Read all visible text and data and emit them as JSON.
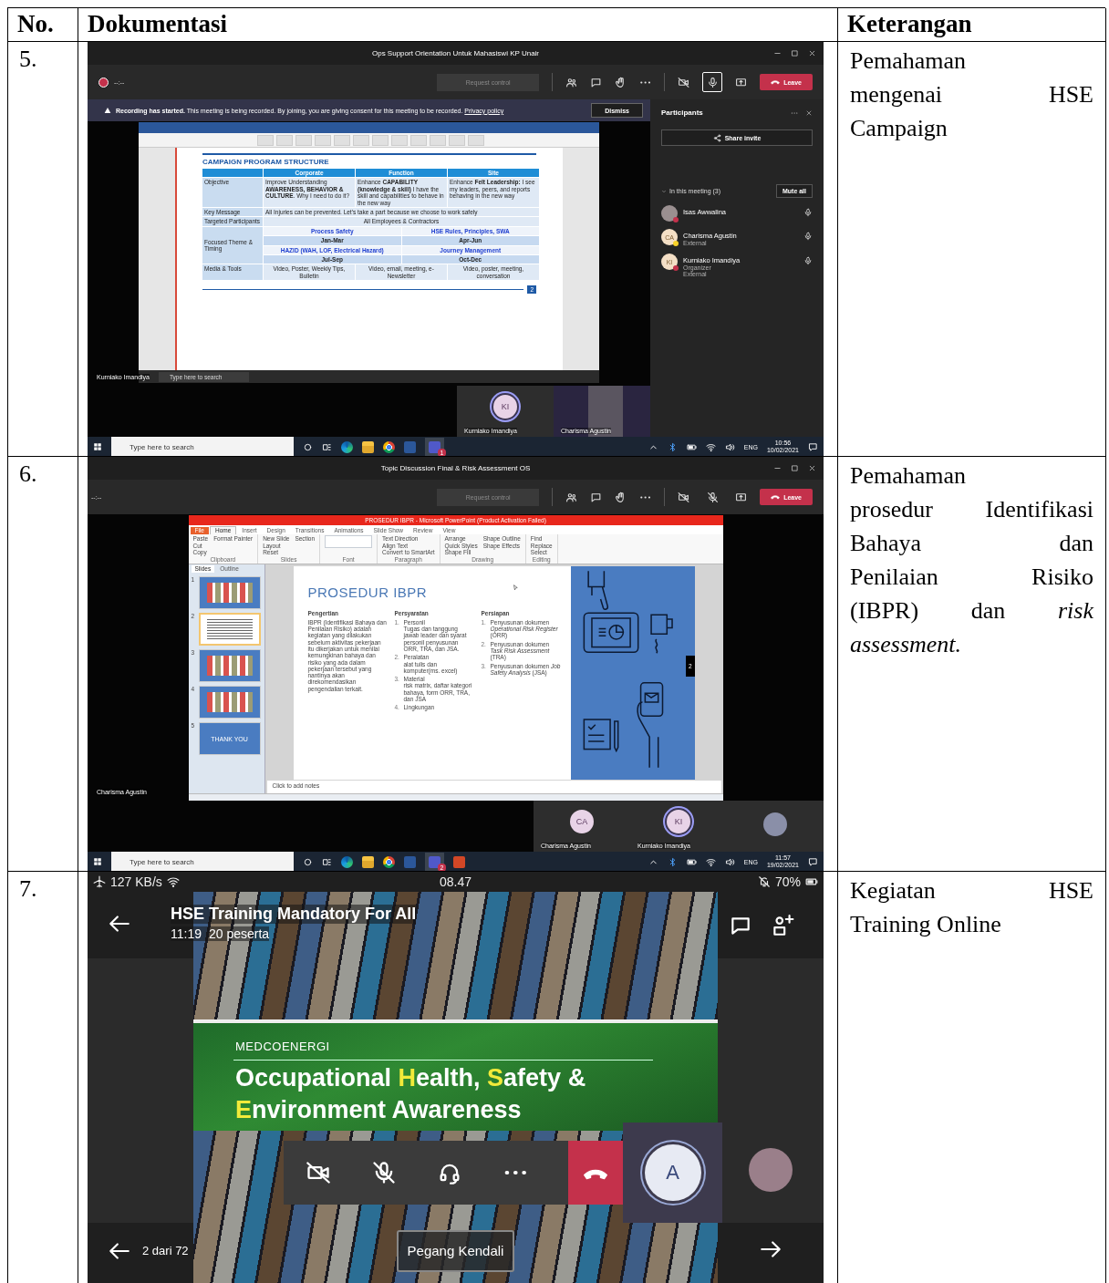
{
  "table": {
    "columns": [
      "No.",
      "Dokumentasi",
      "Keterangan"
    ],
    "rows": [
      {
        "number": "5.",
        "description_lines": [
          "Pemahaman",
          "mengenai HSE",
          "Campaign"
        ],
        "screen": {
          "kind": "teams_desktop",
          "title": "Ops Support Orientation Untuk Mahasiswi KP Unair",
          "recording": true,
          "timer": "--:--",
          "request_control": "Request control",
          "mic_on": true,
          "leave": "Leave",
          "banner": {
            "title": "Recording has started.",
            "text": "This meeting is being recorded. By joining, you are giving consent for this meeting to be recorded.",
            "link": "Privacy policy",
            "button": "Dismiss"
          },
          "shared": {
            "kind": "document",
            "heading": "CAMPAIGN PROGRAM STRUCTURE",
            "columns": [
              "Corporate",
              "Function",
              "Site"
            ],
            "objective": {
              "label": "Objective",
              "cells": [
                "Improve Understanding **AWARENESS, BEHAVIOR & CULTURE**. Why I need to do it?",
                "Enhance **CAPABILITY (knowledge & skill)** I have the skill and capabilities to behave in the new way",
                "Enhance **Felt Leadership:** I see my leaders, peers, and reports behaving in the new way"
              ]
            },
            "key_message": {
              "label": "Key Message",
              "text": "All Injuries can be prevented. Let's take a part because we choose to work safely"
            },
            "targeted": {
              "label": "Targeted Participants",
              "text": "All Employees & Contractors"
            },
            "theme": {
              "label": "Focused Theme & Timing",
              "items": [
                "Process Safety",
                "HSE Rules, Principles, SWA",
                "Jan-Mar",
                "Apr-Jun",
                "HAZID (WAH, LOF, Electrical Hazard)",
                "Journey Management",
                "Jul-Sep",
                "Oct-Dec"
              ]
            },
            "media": {
              "label": "Media & Tools",
              "cells": [
                "Video, Poster, Weekly Tips, Bulletin",
                "Video, email, meeting, e-Newsletter",
                "Video, poster, meeting, conversation"
              ]
            },
            "page": "2",
            "search_placeholder": "Type here to search"
          },
          "presenter": "Kurniako Imandiya",
          "panel": {
            "title": "Participants",
            "share": "Share invite",
            "section": "In this meeting (3)",
            "mute_all": "Mute all",
            "people": [
              {
                "kind": "photo",
                "name": "Isas Awwalina",
                "color": "#c4314b"
              },
              {
                "kind": "initials",
                "initials": "CA",
                "name": "Charisma Agustin",
                "roles": [
                  "External"
                ],
                "color": "#f8d22a"
              },
              {
                "kind": "initials",
                "initials": "KI",
                "name": "Kurniako Imandiya",
                "roles": [
                  "Organizer",
                  "External"
                ],
                "color": "#c4314b"
              }
            ]
          },
          "tiles": [
            {
              "kind": "initials",
              "initials": "KI",
              "name": "Kurniako Imandiya",
              "speaking": true
            },
            {
              "kind": "photo_video",
              "name": "Charisma Agustin",
              "speaking": false
            }
          ],
          "taskbar": {
            "placeholder": "Type here to search",
            "apps": [
              {
                "kind": "edge"
              },
              {
                "kind": "explorer"
              },
              {
                "kind": "chrome"
              },
              {
                "kind": "word"
              },
              {
                "kind": "teams",
                "badge": "1"
              }
            ],
            "language": "ENG",
            "time": "10:56",
            "date": "10/02/2021"
          }
        }
      },
      {
        "number": "6.",
        "description_lines": [
          "Pemahaman",
          "prosedur Identifikasi",
          "Bahaya dan",
          "Penilaian Risiko",
          "(IBPR) dan *risk*",
          "*assessment.*"
        ],
        "screen": {
          "kind": "teams_desktop",
          "title": "Topic Discussion Final & Risk Assessment OS",
          "recording": false,
          "timer": "--:--",
          "request_control": "Request control",
          "mic_on": false,
          "leave": "Leave",
          "shared": {
            "kind": "presentation",
            "window_title": "PROSEDUR IBPR - Microsoft PowerPoint (Product Activation Failed)",
            "tabs": [
              {
                "label": "File",
                "selected": false
              },
              {
                "label": "Home",
                "selected": true
              },
              {
                "label": "Insert",
                "selected": false
              },
              {
                "label": "Design",
                "selected": false
              },
              {
                "label": "Transitions",
                "selected": false
              },
              {
                "label": "Animations",
                "selected": false
              },
              {
                "label": "Slide Show",
                "selected": false
              },
              {
                "label": "Review",
                "selected": false
              },
              {
                "label": "View",
                "selected": false
              }
            ],
            "ribbon_groups": [
              {
                "label": "Clipboard",
                "items": [
                  "Paste",
                  "Cut",
                  "Copy",
                  "Format Painter"
                ]
              },
              {
                "label": "Slides",
                "items": [
                  "New Slide",
                  "Layout",
                  "Reset",
                  "Section"
                ]
              },
              {
                "label": "Font"
              },
              {
                "label": "Paragraph",
                "items": [
                  "Text Direction",
                  "Align Text",
                  "Convert to SmartArt"
                ]
              },
              {
                "label": "Drawing",
                "items": [
                  "Arrange",
                  "Quick Styles",
                  "Shape Fill",
                  "Shape Outline",
                  "Shape Effects"
                ]
              },
              {
                "label": "Editing",
                "items": [
                  "Find",
                  "Replace",
                  "Select"
                ]
              }
            ],
            "pane_tabs": [
              {
                "label": "Slides",
                "selected": true
              },
              {
                "label": "Outline",
                "selected": false
              }
            ],
            "thumbnails": [
              {
                "number": "1",
                "selected": false
              },
              {
                "number": "2",
                "selected": true
              },
              {
                "number": "3",
                "selected": false
              },
              {
                "number": "4",
                "selected": false
              },
              {
                "number": "5",
                "selected": false,
                "text": "THANK YOU"
              }
            ],
            "slide": {
              "title": "PROSEDUR IBPR",
              "page": "2",
              "columns": [
                {
                  "heading": "Pengertian",
                  "text": "IBPR (Identifikasi Bahaya dan Penilaian Risiko) adalah kegiatan yang dilakukan sebelum aktivitas pekerjaan itu dikerjakan untuk menilai kemungkinan bahaya dan risiko yang ada dalam pekerjaan tersebut yang nantinya akan direkomendasikan pengendalian terkait."
                },
                {
                  "heading": "Persyaratan",
                  "items": [
                    {
                      "number": "1.",
                      "title": "Personil",
                      "text": "Tugas dan tanggung jawab leader dan syarat personil penyusunan ORR, TRA, dan JSA."
                    },
                    {
                      "number": "2.",
                      "title": "Peralatan",
                      "text": "alat tulis dan komputer(ms. excel)"
                    },
                    {
                      "number": "3.",
                      "title": "Material",
                      "text": "risk matrix, daftar kategori bahaya, form ORR, TRA, dan JSA"
                    },
                    {
                      "number": "4.",
                      "title": "Lingkungan"
                    }
                  ]
                },
                {
                  "heading": "Persiapan",
                  "items": [
                    {
                      "number": "1.",
                      "text": "Penyusunan dokumen *Operational Risk Register* (ORR)"
                    },
                    {
                      "number": "2.",
                      "text": "Penyusunan dokumen *Task Risk Assessment* (TRA)"
                    },
                    {
                      "number": "3.",
                      "text": "Penyusunan dokumen *Job Safety Analysis* (JSA)"
                    }
                  ]
                }
              ]
            },
            "notes_placeholder": "Click to add notes"
          },
          "presenter": "Charisma Agustin",
          "tiles": [
            {
              "kind": "initials",
              "initials": "CA",
              "name": "Charisma Agustin",
              "speaking": false
            },
            {
              "kind": "initials",
              "initials": "KI",
              "name": "Kurniako Imandiya",
              "speaking": true
            },
            {
              "kind": "photo_avatar",
              "speaking": false
            }
          ],
          "taskbar": {
            "placeholder": "Type here to search",
            "apps": [
              {
                "kind": "edge"
              },
              {
                "kind": "explorer"
              },
              {
                "kind": "chrome"
              },
              {
                "kind": "word"
              },
              {
                "kind": "teams",
                "badge": "2"
              },
              {
                "kind": "powerpoint"
              }
            ],
            "language": "ENG",
            "time": "11:57",
            "date": "19/02/2021"
          }
        }
      },
      {
        "number": "7.",
        "description_lines": [
          "Kegiatan HSE",
          "Training Online"
        ],
        "screen": {
          "kind": "teams_mobile",
          "status": {
            "speed": "127 KB/s",
            "time": "08.47",
            "battery": "70%"
          },
          "title": "HSE Training Mandatory For All",
          "duration": "11:19",
          "attendees": "20 peserta",
          "slide": {
            "logo": "MEDCOENERGI",
            "title_parts": [
              {
                "text": "Occupational ",
                "highlight": false
              },
              {
                "text": "H",
                "highlight": true
              },
              {
                "text": "ealth, ",
                "highlight": false
              },
              {
                "text": "S",
                "highlight": true
              },
              {
                "text": "afety & ",
                "highlight": false
              },
              {
                "text": "E",
                "highlight": true
              },
              {
                "text": "nvironment Awareness",
                "highlight": false
              }
            ]
          },
          "self_avatar": "A",
          "page": "2 dari 72",
          "take_control": "Pegang Kendali"
        }
      }
    ]
  }
}
